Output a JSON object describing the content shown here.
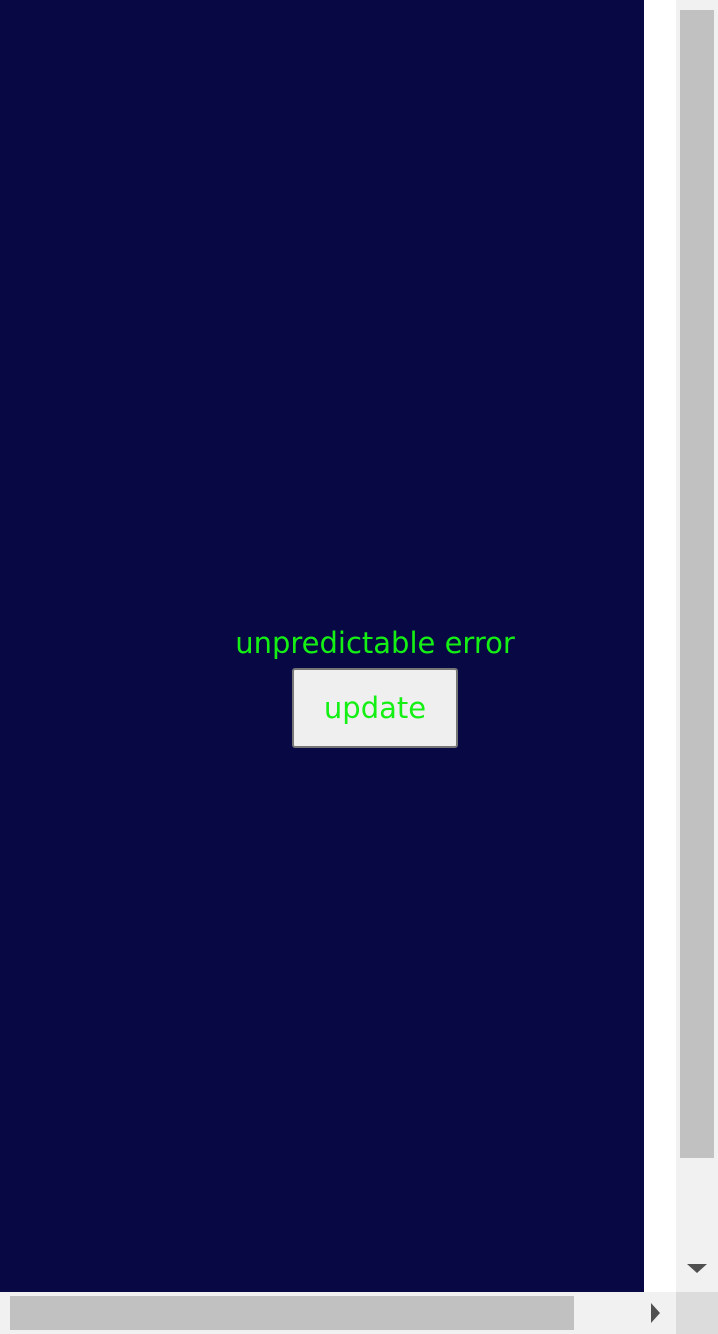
{
  "app": {
    "background_color": "#080844",
    "text_color": "#14f014"
  },
  "main": {
    "error_message": "unpredictable error",
    "update_label": "update"
  },
  "scrollbars": {
    "vertical_icon": "arrow-down-icon",
    "horizontal_icon": "arrow-right-icon"
  }
}
